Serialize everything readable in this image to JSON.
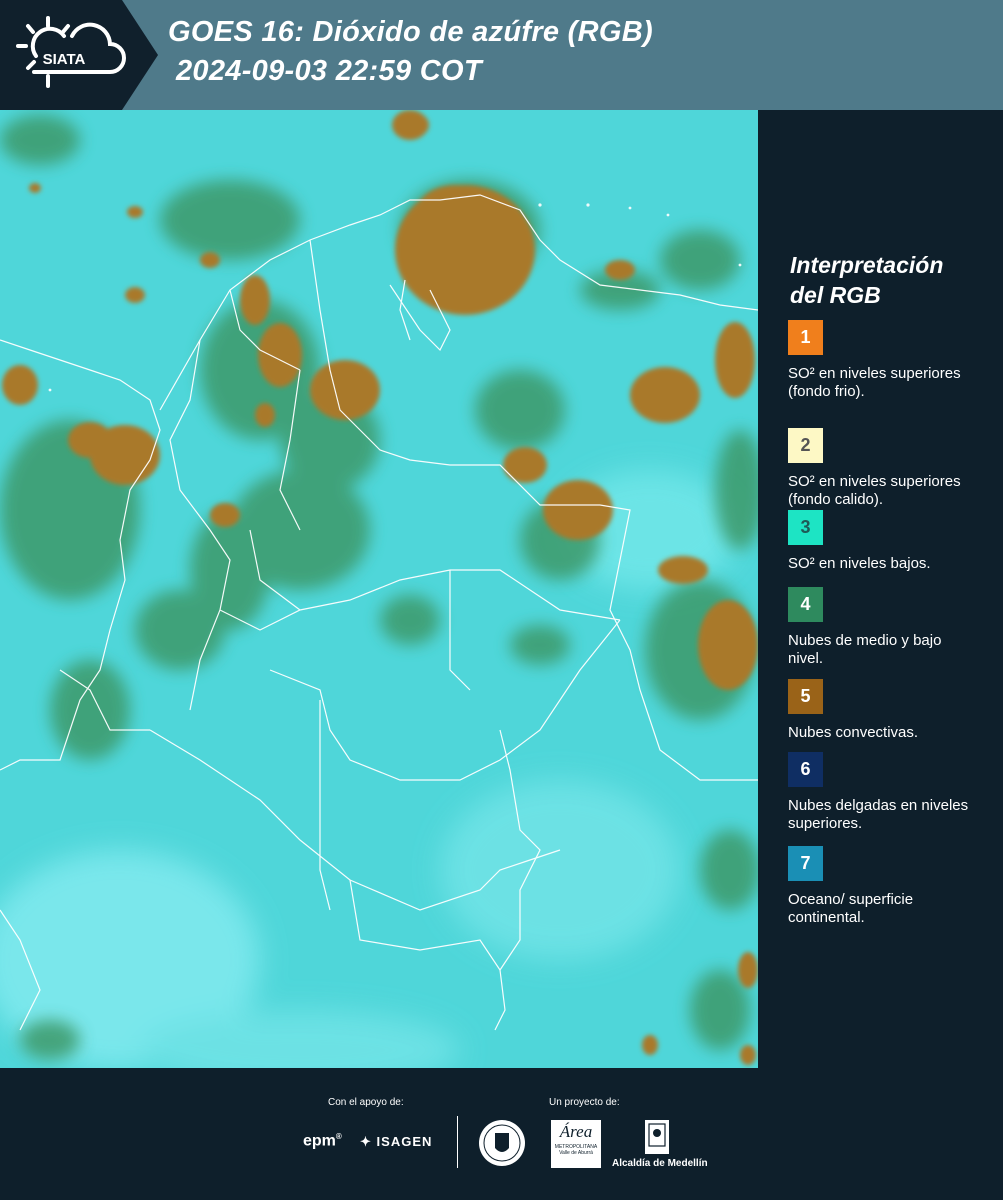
{
  "header": {
    "logo_text": "SIATA",
    "title_line1": "GOES 16: Dióxido de azúfre (RGB)",
    "title_line2": "2024-09-03 22:59 COT"
  },
  "legend": {
    "title_line1": "Interpretación",
    "title_line2": "del RGB",
    "items": [
      {
        "number": "1",
        "color": "#f07f1c",
        "text_color": "#ffffff",
        "text": "SO² en niveles superiores (fondo frio)."
      },
      {
        "number": "2",
        "color": "#fdf8c5",
        "text_color": "#555555",
        "text": "SO² en niveles superiores (fondo calido)."
      },
      {
        "number": "3",
        "color": "#1de4c4",
        "text_color": "#1e5b57",
        "text": "SO² en niveles bajos."
      },
      {
        "number": "4",
        "color": "#2e8a5e",
        "text_color": "#ffffff",
        "text": "Nubes de medio y bajo nivel."
      },
      {
        "number": "5",
        "color": "#9a6318",
        "text_color": "#ffffff",
        "text": "Nubes convectivas."
      },
      {
        "number": "6",
        "color": "#0f2e63",
        "text_color": "#ffffff",
        "text": "Nubes delgadas en niveles superiores."
      },
      {
        "number": "7",
        "color": "#1a8fb5",
        "text_color": "#ffffff",
        "text": "Oceano/ superficie continental."
      }
    ]
  },
  "footer": {
    "support_label": "Con el apoyo de:",
    "project_label": "Un proyecto de:",
    "epm_text": "epm",
    "isagen_text": "ISAGEN",
    "area_text": "Área",
    "area_sub1": "METROPOLITANA",
    "area_sub2": "Valle de Aburrá",
    "alcaldia_text": "Alcaldía de Medellín"
  },
  "colors": {
    "header_bg": "#4f7a8a",
    "dark_bg": "#0e1f2b",
    "map_base": "#4fd8d8",
    "cloud_convective": "#a5762a",
    "cloud_low": "#3d9a6a"
  }
}
